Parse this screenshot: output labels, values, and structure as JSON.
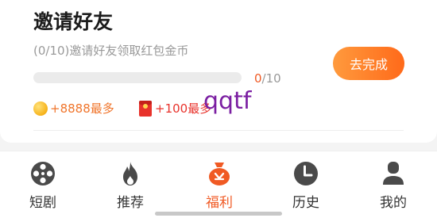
{
  "task": {
    "title": "邀请好友",
    "subtitle": "(0/10)邀请好友领取红包金币",
    "progress_current": "0",
    "progress_total": "/10",
    "progress_fraction": 0,
    "action_label": "去完成"
  },
  "rewards": {
    "coins": "+8888最多",
    "red_packet": "+100最多"
  },
  "overlay_text": "qqtf",
  "tabs": [
    {
      "label": "短剧",
      "icon": "film-reel-icon"
    },
    {
      "label": "推荐",
      "icon": "flame-icon"
    },
    {
      "label": "福利",
      "icon": "gift-bag-icon"
    },
    {
      "label": "历史",
      "icon": "clock-icon"
    },
    {
      "label": "我的",
      "icon": "person-icon"
    }
  ],
  "colors": {
    "accent": "#f05a24",
    "button_gradient_start": "#ff9a3d",
    "button_gradient_end": "#ff6a1a",
    "icon_inactive": "#4a4a4a",
    "overlay": "#7b1fa2"
  }
}
